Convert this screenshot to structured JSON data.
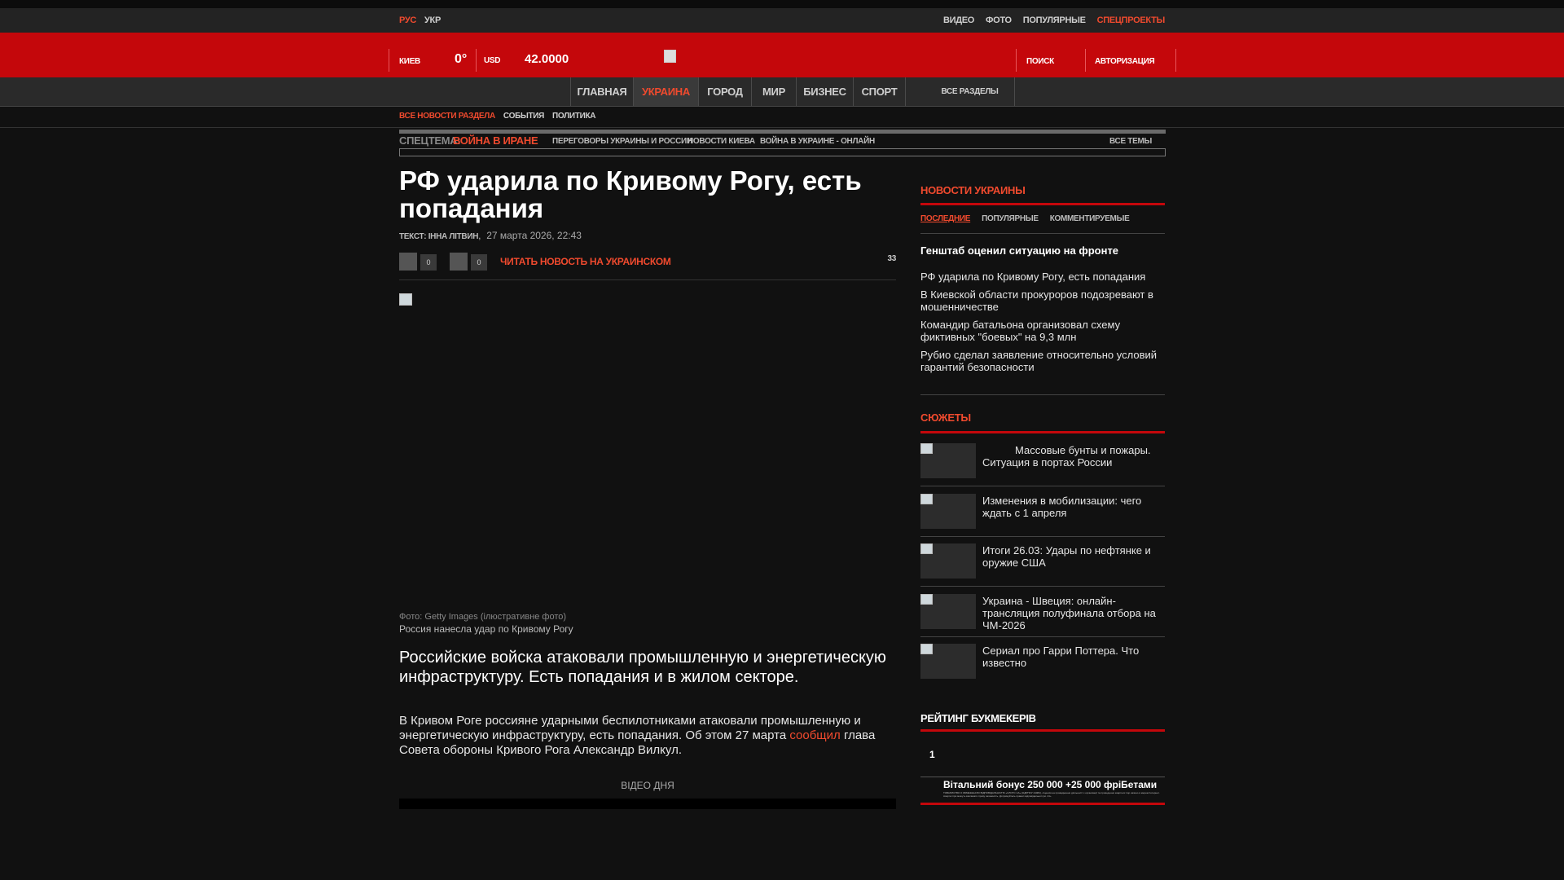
{
  "colors": {
    "accent": "#f04a2e",
    "brand_red": "#c4070b",
    "background": "#111111"
  },
  "lang": {
    "ru": "РУС",
    "ua": "УКР"
  },
  "toplinks": [
    "ВИДЕО",
    "ФОТО",
    "ПОПУЛЯРНЫЕ",
    "СПЕЦПРОЕКТЫ"
  ],
  "header": {
    "city": "КИЕВ",
    "temperature": "0°",
    "currency_label": "USD",
    "currency_value": "42.0000",
    "search": "ПОИСК",
    "login": "АВТОРИЗАЦИЯ",
    "logo_icon": "broken-image-icon"
  },
  "mainnav": {
    "items": [
      "ГЛАВНАЯ",
      "УКРАИНА",
      "ГОРОД",
      "МИР",
      "БИЗНЕС",
      "СПОРТ"
    ],
    "all_sections": "ВСЕ РАЗДЕЛЫ",
    "active": "УКРАИНА"
  },
  "subnav": [
    "ВСЕ НОВОСТИ РАЗДЕЛА",
    "СОБЫТИЯ",
    "ПОЛИТИКА"
  ],
  "special_theme": {
    "label": "СПЕЦТЕМА:",
    "name": "ВОЙНА В ИРАНЕ",
    "links": [
      "ПЕРЕГОВОРЫ УКРАИНЫ И РОССИИ",
      "НОВОСТИ КИЕВА",
      "ВОЙНА В УКРАИНЕ - ОНЛАЙН"
    ],
    "all_topics": "ВСЕ ТЕМЫ"
  },
  "article": {
    "title": "РФ ударила по Кривому Рогу, есть попадания",
    "author": "ТЕКСТ: ІННА ЛІТВИН",
    "date": "27 марта 2026, 22:43",
    "share_count_1": "0",
    "share_count_2": "0",
    "read_ua": "ЧИТАТЬ НОВОСТЬ НА УКРАИНСКОМ",
    "comments_count": "33",
    "photo_credit": "Фото: Getty Images (ілюстративне фото)",
    "photo_caption": "Россия нанесла удар по Кривому Рогу",
    "lead": "Российские войска атаковали промышленную и энергетическую инфраструктуру. Есть попадания и в жилом секторе.",
    "body_before": "В Кривом Роге россияне ударными беспилотниками атаковали промышленную и энергетическую инфраструктуру, есть попадания. Об этом 27 марта ",
    "body_link": "сообщил",
    "body_after": " глава Совета обороны Кривого Рога Александр Вилкул.",
    "video_label": "ВІДЕО ДНЯ"
  },
  "sidebar": {
    "news_title": "НОВОСТИ УКРАИНЫ",
    "tabs": [
      "ПОСЛЕДНИЕ",
      "ПОПУЛЯРНЫЕ",
      "КОММЕНТИРУЕМЫЕ"
    ],
    "news": [
      "Генштаб оценил ситуацию на фронте",
      "РФ ударила по Кривому Рогу, есть попадания",
      "В Киевской области прокуроров подозревают в мошенничестве",
      "Командир батальона организовал схему фиктивных \"боевых\" на 9,3 млн",
      "Рубио сделал заявление относительно условий гарантий безопасности"
    ],
    "stories_title": "СЮЖЕТЫ",
    "stories": [
      "Массовые бунты и пожары. Ситуация в портах России",
      "Изменения в мобилизации: чего ждать с 1 апреля",
      "Итоги 26.03: Удары по нефтянке и оружие США",
      "Украина - Швеция: онлайн-трансляция полуфинала отбора на ЧМ-2026",
      "Сериал про Гарри Поттера. Что известно"
    ],
    "rating_title": "РЕЙТИНГ БУКМЕКЕРІВ",
    "rating_rank": "1",
    "bonus_title": "Вітальний бонус 250 000 +25 000 фріБетами",
    "bonus_fine": "ТОВАРИСТВО З ОБМЕЖЕНОЮ ВІДПОВІДАЛЬНІСТЮ «СЛОТС UA» (ЄДРПОУ 44084), ліцензія на провадження діяльності з організації та проведення азартних ігор казино в мережі Інтернет. Азартні ігри можуть викликати ігрову залежність. Дотримуйтесь правил відповідальної гри. 21+"
  }
}
